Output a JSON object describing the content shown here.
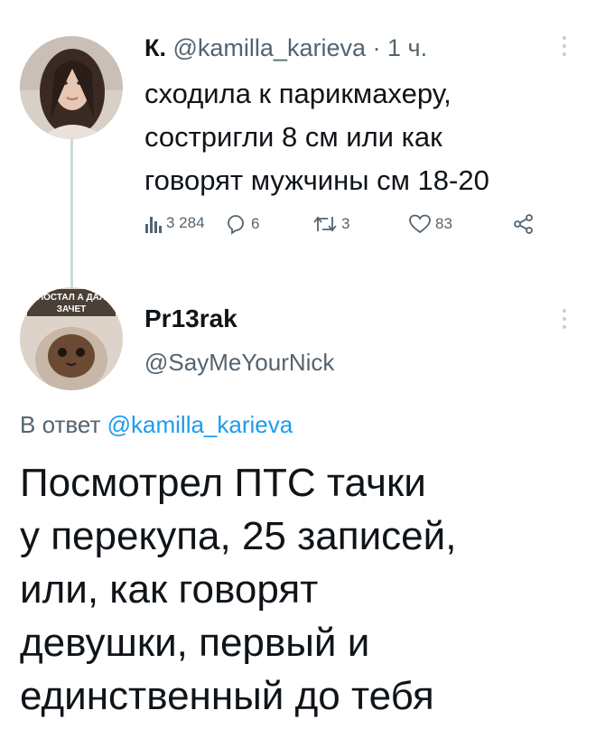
{
  "tweet1": {
    "display_name": "К.",
    "handle": "@kamilla_karieva",
    "separator": "·",
    "time": "1 ч.",
    "text_lines": [
      "сходила к парикмахеру,",
      "состригли 8 см или как",
      "говорят мужчины см 18-20"
    ],
    "stats": {
      "views": "3 284",
      "replies": "6",
      "retweets": "3",
      "likes": "83"
    },
    "icons": [
      "views-icon",
      "reply-icon",
      "retweet-icon",
      "like-icon",
      "share-icon",
      "more-icon"
    ]
  },
  "tweet2": {
    "display_name": "Pr13rak",
    "handle": "@SayMeYourNick",
    "reply_prefix": "В ответ",
    "reply_mention": "@kamilla_karieva",
    "text_lines": [
      "Посмотрел ПТС тачки",
      "у перекупа, 25 записей,",
      "или, как говорят",
      "девушки, первый и",
      "единственный до тебя"
    ],
    "avatar_caption": [
      "ПОСТАЛ А ДАЛ",
      "ЗАЧЕТ"
    ]
  },
  "colors": {
    "text": "#0f1419",
    "secondary": "#536471",
    "link": "#1d9bf0",
    "thread_line": "#cfd9de"
  }
}
